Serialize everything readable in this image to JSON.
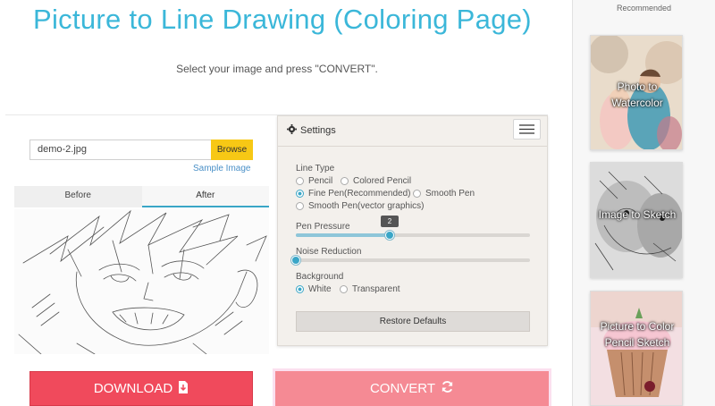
{
  "header": {
    "title": "Picture to Line Drawing (Coloring Page)",
    "subtitle": "Select your image and press \"CONVERT\"."
  },
  "upload": {
    "filename": "demo-2.jpg",
    "browse_label": "Browse",
    "sample_link": "Sample Image"
  },
  "preview": {
    "tabs": [
      {
        "label": "Before",
        "active": false
      },
      {
        "label": "After",
        "active": true
      }
    ]
  },
  "settings": {
    "title": "Settings",
    "line_type": {
      "label": "Line Type",
      "options": [
        {
          "label": "Pencil",
          "selected": false
        },
        {
          "label": "Colored Pencil",
          "selected": false
        },
        {
          "label": "Fine Pen(Recommended)",
          "selected": true
        },
        {
          "label": "Smooth Pen",
          "selected": false
        },
        {
          "label": "Smooth Pen(vector graphics)",
          "selected": false
        }
      ]
    },
    "pen_pressure": {
      "label": "Pen Pressure",
      "value": "2",
      "fraction": 0.4
    },
    "noise_reduction": {
      "label": "Noise Reduction",
      "fraction": 0.0
    },
    "background": {
      "label": "Background",
      "options": [
        {
          "label": "White",
          "selected": true
        },
        {
          "label": "Transparent",
          "selected": false
        }
      ]
    },
    "restore_label": "Restore Defaults"
  },
  "actions": {
    "download_label": "DOWNLOAD",
    "convert_label": "CONVERT"
  },
  "sidebar": {
    "title": "Recommended",
    "cards": [
      {
        "label": "Photo to Watercolor"
      },
      {
        "label": "Image to Sketch"
      },
      {
        "label": "Picture to Color Pencil Sketch"
      }
    ]
  },
  "colors": {
    "title": "#3bb7d9",
    "accent": "#3aa6c7",
    "browse": "#f7c815",
    "download": "#f04a5c",
    "convert": "#f58a94"
  },
  "icons": [
    "gear-icon",
    "hamburger-menu-icon",
    "download-icon",
    "refresh-icon"
  ]
}
